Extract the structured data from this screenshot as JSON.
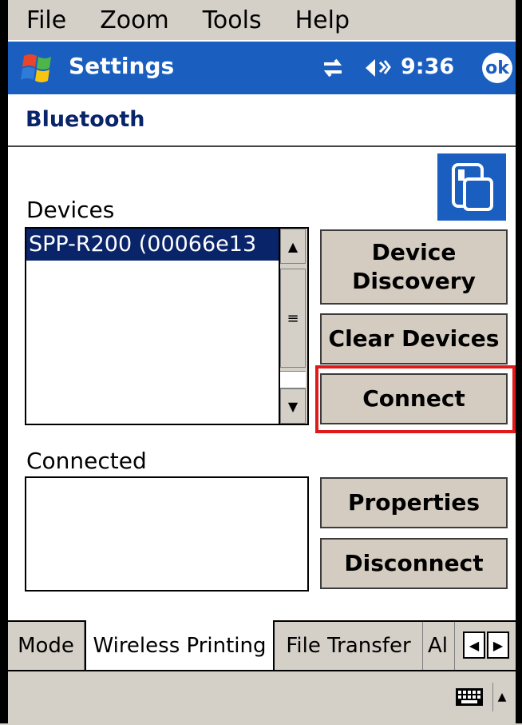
{
  "menu": {
    "items": [
      "File",
      "Zoom",
      "Tools",
      "Help"
    ]
  },
  "titlebar": {
    "title": "Settings",
    "time": "9:36",
    "ok_label": "ok"
  },
  "header": {
    "title": "Bluetooth"
  },
  "devices": {
    "label": "Devices",
    "items": [
      "SPP-R200 (00066e13"
    ]
  },
  "buttons": {
    "device_discovery": "Device\nDiscovery",
    "clear_devices": "Clear Devices",
    "connect": "Connect",
    "properties": "Properties",
    "disconnect": "Disconnect"
  },
  "connected": {
    "label": "Connected"
  },
  "tabs": [
    "Mode",
    "Wireless Printing",
    "File Transfer",
    "Al"
  ],
  "colors": {
    "titlebar": "#1a5fbf",
    "selection": "#0a246a",
    "highlight": "#e01a1a"
  }
}
